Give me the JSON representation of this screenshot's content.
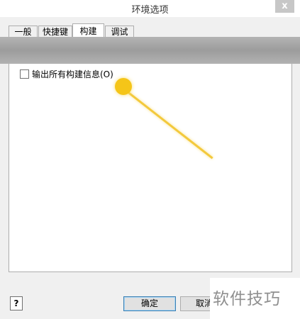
{
  "window": {
    "title": "环境选项",
    "close_glyph": "x"
  },
  "tabs": [
    {
      "label": "一般"
    },
    {
      "label": "快捷键"
    },
    {
      "label": "构建"
    },
    {
      "label": "调试"
    }
  ],
  "active_tab": "构建",
  "options": [
    {
      "label": "输出所有构建信息(O)",
      "checked": false
    }
  ],
  "buttons": {
    "help": "?",
    "ok": "确定",
    "cancel": "取消"
  },
  "watermark": "软件技巧",
  "colors": {
    "highlight": "#f5c518",
    "band": "#a8a8a8"
  }
}
